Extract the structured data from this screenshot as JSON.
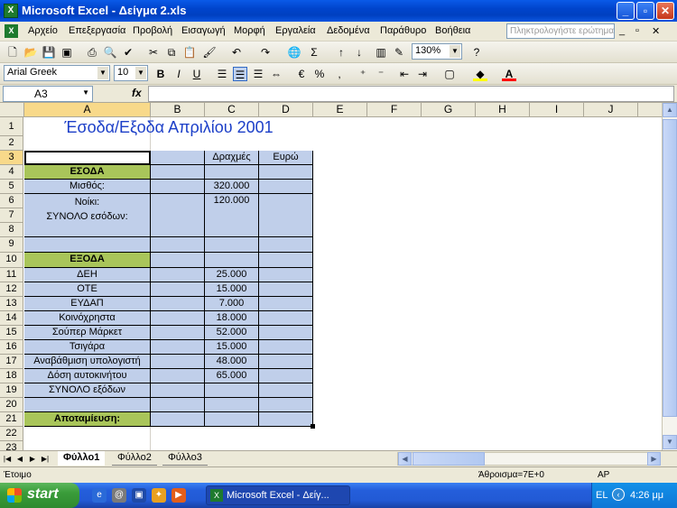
{
  "window": {
    "title": "Microsoft Excel - Δείγμα 2.xls"
  },
  "menu": {
    "items": [
      "Αρχείο",
      "Επεξεργασία",
      "Προβολή",
      "Εισαγωγή",
      "Μορφή",
      "Εργαλεία",
      "Δεδομένα",
      "Παράθυρο",
      "Βοήθεια"
    ],
    "ask_placeholder": "Πληκτρολογήστε ερώτημα"
  },
  "toolbar": {
    "zoom": "130%",
    "font_name": "Arial Greek",
    "font_size": "10"
  },
  "formula_bar": {
    "name_box": "A3",
    "fx": "fx",
    "formula": ""
  },
  "columns": [
    "A",
    "B",
    "C",
    "D",
    "E",
    "F",
    "G",
    "H",
    "I",
    "J"
  ],
  "rows": [
    "1",
    "2",
    "3",
    "4",
    "5",
    "6",
    "7",
    "8",
    "9",
    "10",
    "11",
    "12",
    "13",
    "14",
    "15",
    "16",
    "17",
    "18",
    "19",
    "20",
    "21",
    "22",
    "23"
  ],
  "sheet": {
    "title": "Έσοδα/Εξοδα Απριλίου 2001",
    "header_drachmes": "Δραχμές",
    "header_euro": "Ευρώ",
    "income_header": "ΕΣΟΔΑ",
    "income_salary_label": "Μισθός:",
    "income_salary_value": "320.000",
    "income_rent_label": "Νοίκι:",
    "income_rent_value": "120.000",
    "income_total_label": "ΣΥΝΟΛΟ εσόδων:",
    "expense_header": "ΕΞΟΔΑ",
    "expenses": [
      {
        "label": "ΔΕΗ",
        "value": "25.000"
      },
      {
        "label": "ΟΤΕ",
        "value": "15.000"
      },
      {
        "label": "ΕΥΔΑΠ",
        "value": "7.000"
      },
      {
        "label": "Κοινόχρηστα",
        "value": "18.000"
      },
      {
        "label": "Σούπερ Μάρκετ",
        "value": "52.000"
      },
      {
        "label": "Τσιγάρα",
        "value": "15.000"
      },
      {
        "label": "Αναβάθμιση υπολογιστή",
        "value": "48.000"
      },
      {
        "label": "Δόση αυτοκινήτου",
        "value": "65.000"
      }
    ],
    "expense_total_label": "ΣΥΝΟΛΟ εξόδων",
    "savings_label": "Αποταμίευση:"
  },
  "tabs": [
    "Φύλλο1",
    "Φύλλο2",
    "Φύλλο3"
  ],
  "status": {
    "left": "Έτοιμο",
    "sum": "Άθροισμα=7E+0",
    "mode": "ΑΡ"
  },
  "taskbar": {
    "start": "start",
    "task": "Microsoft Excel - Δείγ...",
    "lang": "EL",
    "time": "4:26 μμ"
  }
}
